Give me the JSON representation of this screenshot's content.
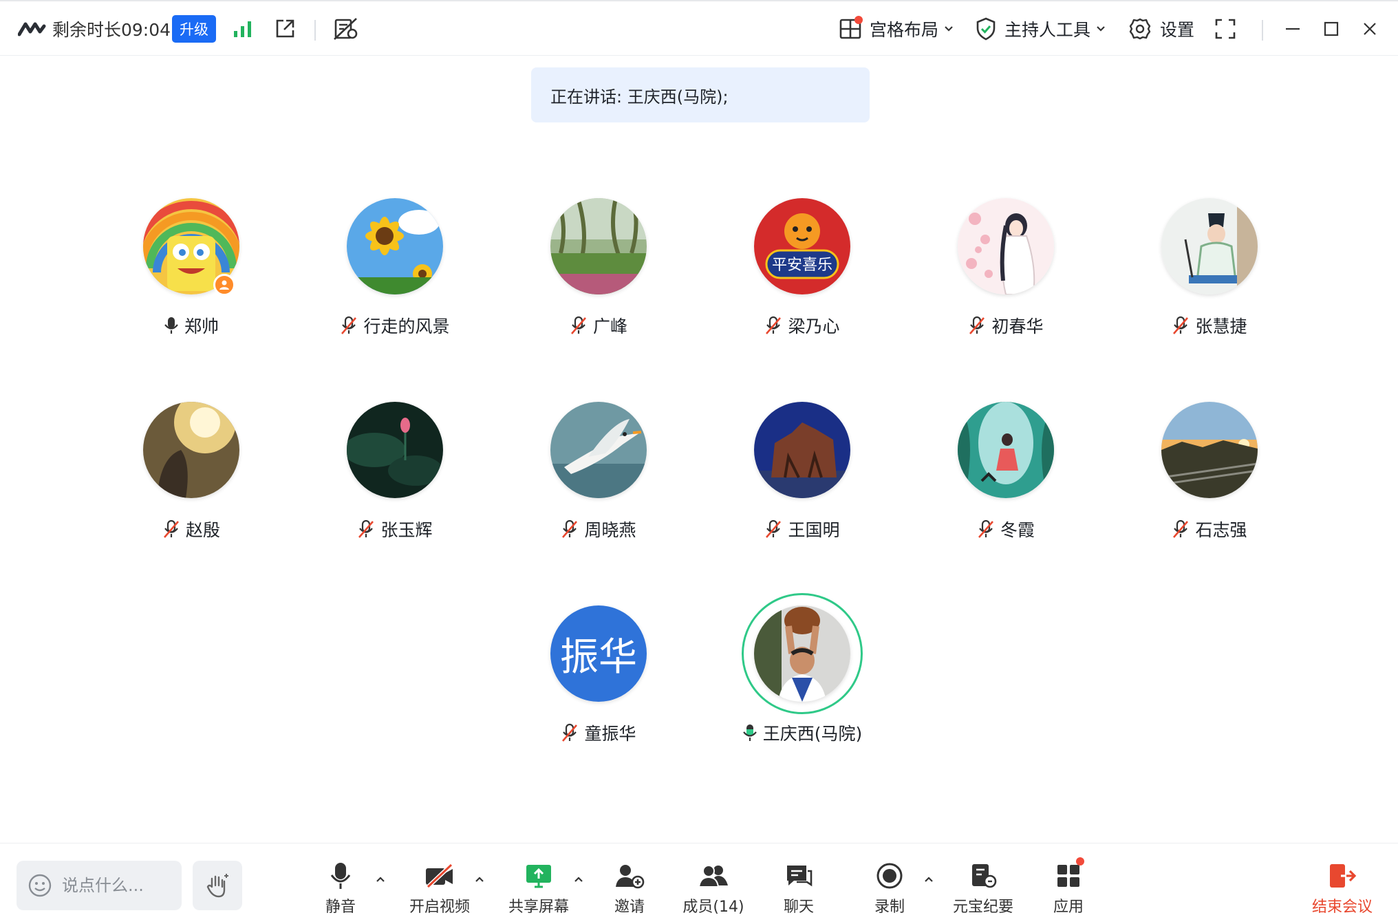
{
  "topbar": {
    "timer": "剩余时长09:04",
    "upgrade_label": "升级",
    "layout_label": "宫格布局",
    "host_tools_label": "主持人工具",
    "settings_label": "设置"
  },
  "speaking_banner": "正在讲话: 王庆西(马院);",
  "participants": [
    {
      "name": "郑帅",
      "mic": "on",
      "host": true
    },
    {
      "name": "行走的风景",
      "mic": "muted"
    },
    {
      "name": "广峰",
      "mic": "muted"
    },
    {
      "name": "梁乃心",
      "mic": "muted"
    },
    {
      "name": "初春华",
      "mic": "muted"
    },
    {
      "name": "张慧捷",
      "mic": "muted"
    },
    {
      "name": "赵殷",
      "mic": "muted"
    },
    {
      "name": "张玉辉",
      "mic": "muted"
    },
    {
      "name": "周晓燕",
      "mic": "muted"
    },
    {
      "name": "王国明",
      "mic": "muted"
    },
    {
      "name": "冬霞",
      "mic": "muted"
    },
    {
      "name": "石志强",
      "mic": "muted"
    },
    {
      "name": "童振华",
      "mic": "muted",
      "initials": "振华"
    },
    {
      "name": "王庆西(马院)",
      "mic": "speaking"
    }
  ],
  "avatar_badge_text": "平安喜乐",
  "toolbar": {
    "chat_placeholder": "说点什么...",
    "mute_label": "静音",
    "video_label": "开启视频",
    "share_label": "共享屏幕",
    "invite_label": "邀请",
    "members_label": "成员(14)",
    "chat_label": "聊天",
    "record_label": "录制",
    "minutes_label": "元宝纪要",
    "apps_label": "应用",
    "end_label": "结束会议"
  },
  "colors": {
    "accent_blue": "#1a6bf5",
    "speaking_green": "#2fc988",
    "muted_red": "#e8482f",
    "signal_green": "#22b35e",
    "banner_bg": "#e9f1fe"
  }
}
